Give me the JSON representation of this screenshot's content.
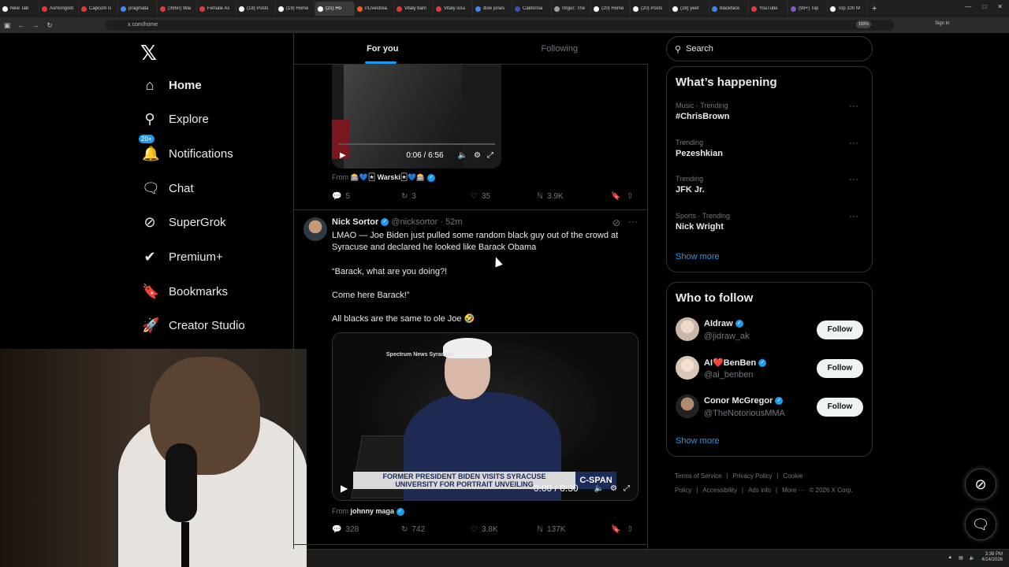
{
  "browser": {
    "tabs": [
      {
        "title": "New Tab",
        "color": "#ffffff"
      },
      {
        "title": "Asmongold",
        "color": "#e53935"
      },
      {
        "title": "Capcom is",
        "color": "#e53935"
      },
      {
        "title": "pragmata",
        "color": "#4285f4"
      },
      {
        "title": "(3950) Wai",
        "color": "#e53935"
      },
      {
        "title": "Female As",
        "color": "#e53935"
      },
      {
        "title": "(18) Posts",
        "color": "#ffffff"
      },
      {
        "title": "(19) Home",
        "color": "#ffffff"
      },
      {
        "title": "(21) Ho",
        "color": "#ffffff"
      },
      {
        "title": "r/Livestrea",
        "color": "#ff5722"
      },
      {
        "title": "Vitaly bam",
        "color": "#e53935"
      },
      {
        "title": "Vitaly issu",
        "color": "#e53935"
      },
      {
        "title": "dow jones",
        "color": "#4285f4"
      },
      {
        "title": "California",
        "color": "#3f51b5"
      },
      {
        "title": "Imgur: The",
        "color": "#9e9e9e"
      },
      {
        "title": "(20) Home",
        "color": "#ffffff"
      },
      {
        "title": "(20) Posts",
        "color": "#ffffff"
      },
      {
        "title": "(28) yeet",
        "color": "#ffffff"
      },
      {
        "title": "blackface",
        "color": "#4285f4"
      },
      {
        "title": "YouTube",
        "color": "#e53935"
      },
      {
        "title": "(99+) Top",
        "color": "#7e57c2"
      },
      {
        "title": "Top 100 M",
        "color": "#ffffff"
      }
    ],
    "url": "x.com/home",
    "zoom": "150%",
    "signin": "Sign in"
  },
  "sidebar": {
    "home": "Home",
    "explore": "Explore",
    "notifications": "Notifications",
    "notifications_badge": "20+",
    "chat": "Chat",
    "supergrok": "SuperGrok",
    "premium": "Premium+",
    "bookmarks": "Bookmarks",
    "creator_studio": "Creator Studio"
  },
  "feed": {
    "tab_for_you": "For you",
    "tab_following": "Following",
    "post1": {
      "video_time": "0:06 / 6:56",
      "from_label": "From",
      "from_name": "🎰💙🃏 Warski🃏💙🎰",
      "replies": "5",
      "reposts": "3",
      "likes": "35",
      "views": "3.9K"
    },
    "post2": {
      "name": "Nick Sortor",
      "handle": "@nicksortor",
      "time": "52m",
      "text_line1": "LMAO — Joe Biden just pulled some random black guy out of the crowd at",
      "text_line2": "Syracuse and declared he looked like Barack Obama",
      "quote1": "“Barack, what are you doing?!",
      "quote2": "Come here Barack!”",
      "quote3": "All blacks are the same to ole Joe 🤣",
      "video_watermark": "Spectrum News Syracuse",
      "chyron_line1": "FORMER PRESIDENT BIDEN VISITS SYRACUSE",
      "chyron_line2": "UNIVERSITY FOR PORTRAIT UNVEILING",
      "network": "C-SPAN",
      "video_time": "0:00 / 0:30",
      "from_label": "From",
      "from_name": "johnny maga",
      "replies": "328",
      "reposts": "742",
      "likes": "3.8K",
      "views": "137K"
    }
  },
  "right": {
    "search_placeholder": "Search",
    "whats_happening": "What’s happening",
    "trends": [
      {
        "meta": "Music · Trending",
        "topic": "#ChrisBrown"
      },
      {
        "meta": "Trending",
        "topic": "Pezeshkian"
      },
      {
        "meta": "Trending",
        "topic": "JFK Jr."
      },
      {
        "meta": "Sports · Trending",
        "topic": "Nick Wright"
      }
    ],
    "show_more": "Show more",
    "who_to_follow": "Who to follow",
    "follows": [
      {
        "name": "AIdraw",
        "handle": "@jidraw_ak",
        "button": "Follow"
      },
      {
        "name": "AI❤️BenBen",
        "handle": "@ai_benben",
        "button": "Follow"
      },
      {
        "name": "Conor McGregor",
        "handle": "@TheNotoriousMMA",
        "button": "Follow"
      }
    ],
    "show_more_follow": "Show more",
    "footer": [
      "Terms of Service",
      "|",
      "Privacy Policy",
      "|",
      "Cookie Policy",
      "|",
      "Accessibility",
      "|",
      "Ads info",
      "|",
      "More ···",
      "© 2026 X Corp."
    ]
  },
  "taskbar": {
    "time": "3:38 PM",
    "date": "4/14/2026"
  },
  "colors": {
    "accent": "#1d9bf0",
    "background": "#000000",
    "border": "#2f3336",
    "muted": "#71767b"
  }
}
